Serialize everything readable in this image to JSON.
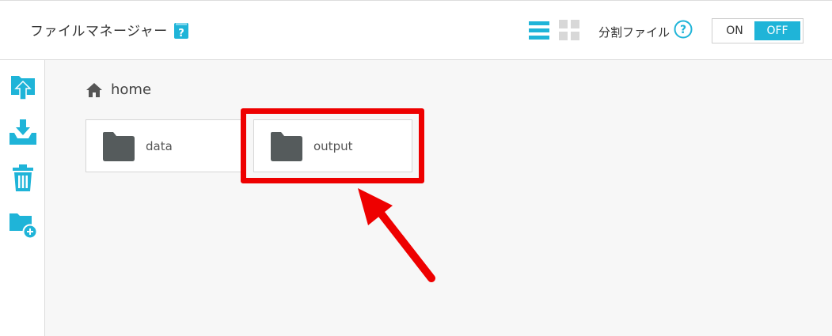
{
  "header": {
    "title": "ファイルマネージャー",
    "split_label": "分割ファイル",
    "toggle_on": "ON",
    "toggle_off": "OFF"
  },
  "sidebar": {
    "items": [
      "upload-icon",
      "download-icon",
      "trash-icon",
      "add-folder-icon"
    ]
  },
  "breadcrumb": {
    "label": "home"
  },
  "folders": [
    {
      "label": "data"
    },
    {
      "label": "output"
    }
  ],
  "colors": {
    "accent": "#1fb4d8",
    "folder": "#555b5c",
    "highlight": "#ee0000"
  }
}
